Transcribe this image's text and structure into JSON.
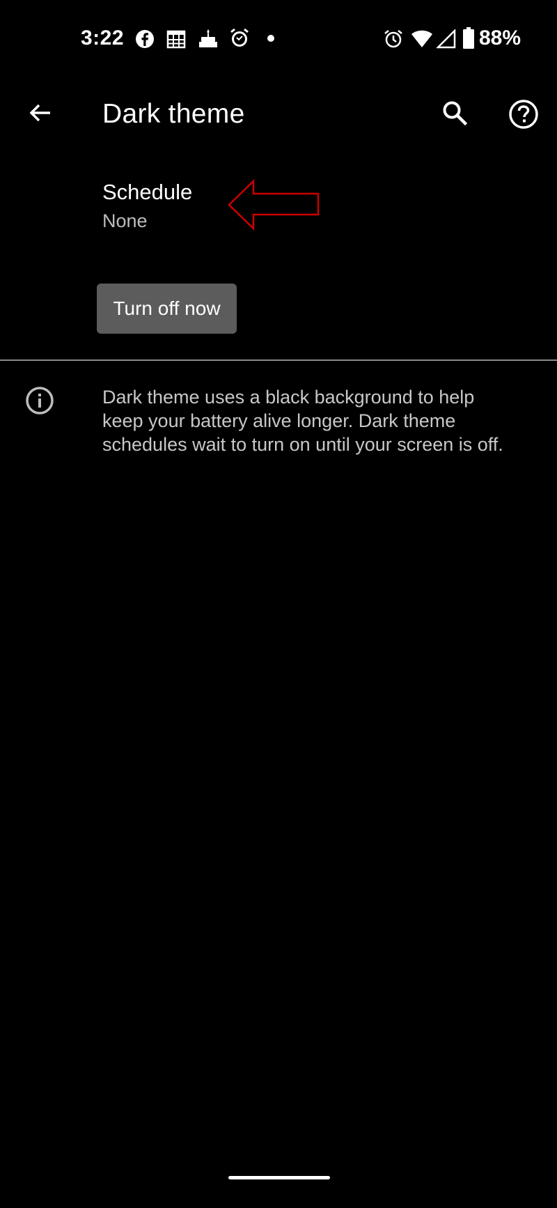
{
  "status_bar": {
    "time": "3:22",
    "battery": "88%",
    "notification_icons": [
      "facebook-icon",
      "calendar-icon",
      "cake-icon",
      "alarm-clock-icon",
      "dot-icon"
    ],
    "system_icons": [
      "alarm-icon",
      "wifi-icon",
      "signal-icon",
      "battery-icon"
    ]
  },
  "app_bar": {
    "title": "Dark theme",
    "back_icon": "arrow-back-icon",
    "search_icon": "search-icon",
    "help_icon": "help-icon"
  },
  "schedule": {
    "title": "Schedule",
    "value": "None"
  },
  "actions": {
    "turn_off_label": "Turn off now"
  },
  "info": {
    "icon": "info-icon",
    "text": "Dark theme uses a black background to help keep your battery alive longer. Dark theme schedules wait to turn on until your screen is off."
  },
  "colors": {
    "background": "#000000",
    "text_primary": "#ffffff",
    "text_secondary": "#bdbdbd",
    "button_bg": "#5c5c5c",
    "annotation_arrow": "#cc0000"
  }
}
